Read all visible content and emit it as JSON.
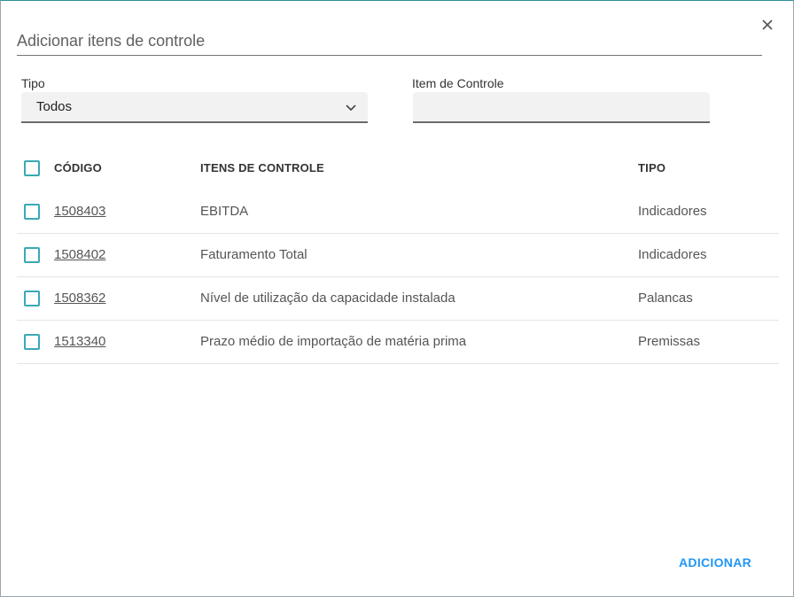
{
  "dialog": {
    "title": "Adicionar itens de controle",
    "close_icon": "close-icon"
  },
  "filters": {
    "tipo_label": "Tipo",
    "tipo_value": "Todos",
    "item_label": "Item de Controle",
    "item_value": ""
  },
  "table": {
    "headers": {
      "codigo": "CÓDIGO",
      "itens": "ITENS DE CONTROLE",
      "tipo": "TIPO"
    },
    "rows": [
      {
        "codigo": "1508403",
        "item": "EBITDA",
        "tipo": "Indicadores"
      },
      {
        "codigo": "1508402",
        "item": "Faturamento Total",
        "tipo": "Indicadores"
      },
      {
        "codigo": "1508362",
        "item": "Nível de utilização da capacidade instalada",
        "tipo": "Palancas"
      },
      {
        "codigo": "1513340",
        "item": "Prazo médio de importação de matéria prima",
        "tipo": "Premissas"
      }
    ]
  },
  "actions": {
    "add_label": "ADICIONAR"
  },
  "colors": {
    "accent": "#2196f3",
    "checkbox": "#3aa9b5"
  }
}
